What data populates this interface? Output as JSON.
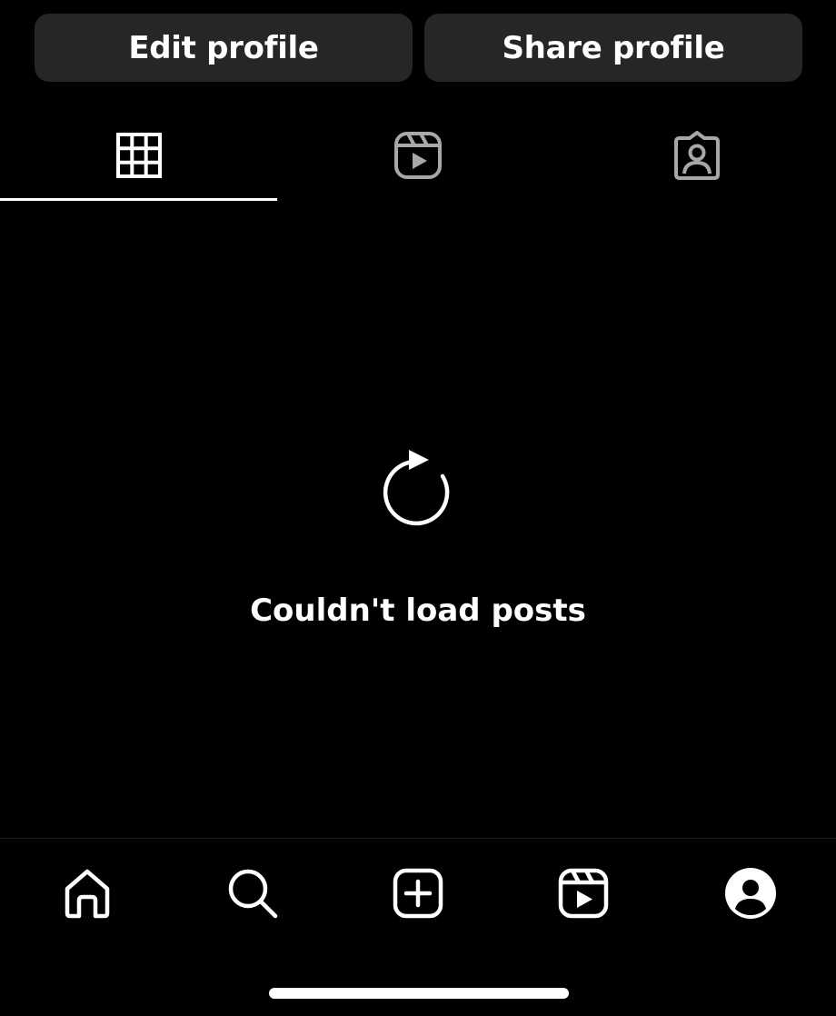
{
  "actions": {
    "edit_profile_label": "Edit profile",
    "share_profile_label": "Share profile"
  },
  "tabs": [
    {
      "name": "posts-grid",
      "icon": "grid-icon",
      "selected": true
    },
    {
      "name": "reels",
      "icon": "reels-icon",
      "selected": false
    },
    {
      "name": "tagged",
      "icon": "tagged-person-icon",
      "selected": false
    }
  ],
  "empty_state": {
    "icon": "refresh-icon",
    "message": "Couldn't load posts"
  },
  "bottom_nav": [
    {
      "name": "home",
      "icon": "home-icon"
    },
    {
      "name": "search",
      "icon": "search-icon"
    },
    {
      "name": "create",
      "icon": "add-post-icon"
    },
    {
      "name": "reels",
      "icon": "reels-icon"
    },
    {
      "name": "profile",
      "icon": "profile-avatar-icon"
    }
  ],
  "colors": {
    "background": "#000000",
    "button_bg": "#262626",
    "foreground": "#ffffff",
    "inactive_icon": "#a8a8a8"
  }
}
